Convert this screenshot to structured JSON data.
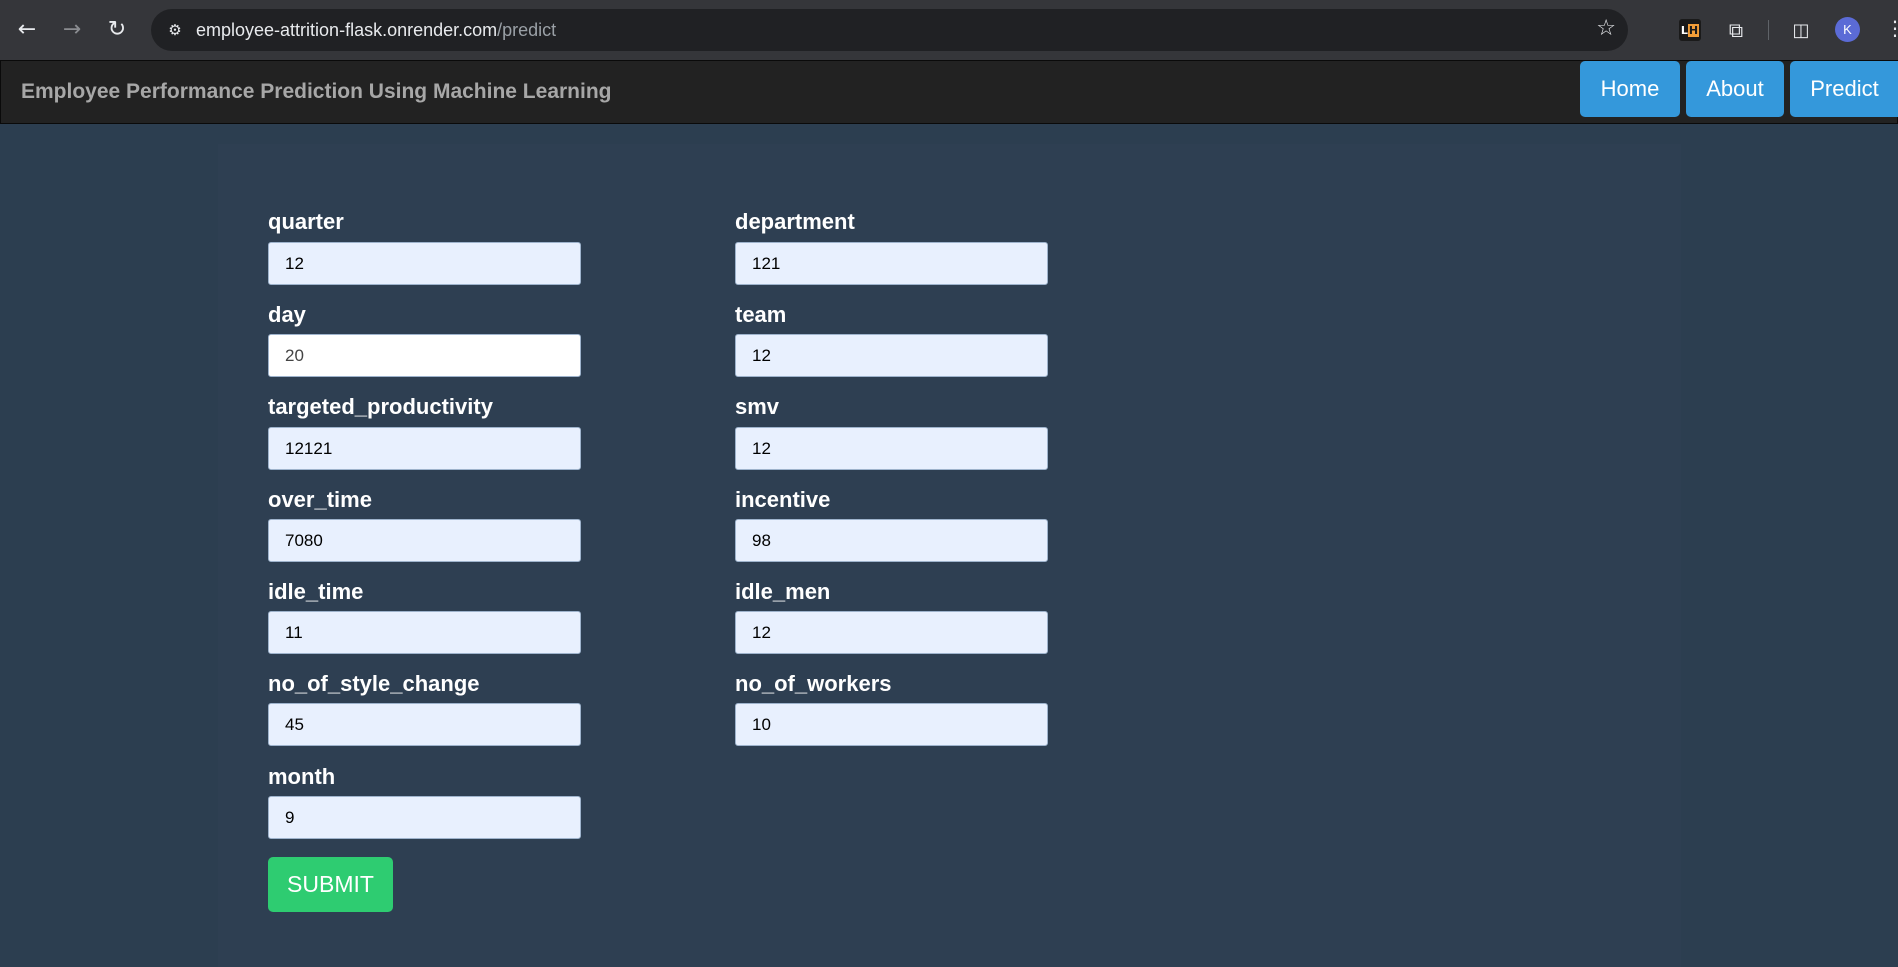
{
  "browser": {
    "url_host": "employee-attrition-flask.onrender.com",
    "url_path": "/predict",
    "avatar_letter": "K",
    "lh_ext_left": "L",
    "lh_ext_right": "H"
  },
  "header": {
    "title": "Employee Performance Prediction Using Machine Learning",
    "nav": {
      "home": "Home",
      "about": "About",
      "predict": "Predict"
    }
  },
  "form": {
    "left": [
      {
        "label": "quarter",
        "value": "12"
      },
      {
        "label": "day",
        "value": "20"
      },
      {
        "label": "targeted_productivity",
        "value": "12121"
      },
      {
        "label": "over_time",
        "value": "7080"
      },
      {
        "label": "idle_time",
        "value": "11"
      },
      {
        "label": "no_of_style_change",
        "value": "45"
      },
      {
        "label": "month",
        "value": "9"
      }
    ],
    "right": [
      {
        "label": "department",
        "value": "121"
      },
      {
        "label": "team",
        "value": "12"
      },
      {
        "label": "smv",
        "value": "12"
      },
      {
        "label": "incentive",
        "value": "98"
      },
      {
        "label": "idle_men",
        "value": "12"
      },
      {
        "label": "no_of_workers",
        "value": "10"
      }
    ],
    "submit_label": "SUBMIT"
  }
}
